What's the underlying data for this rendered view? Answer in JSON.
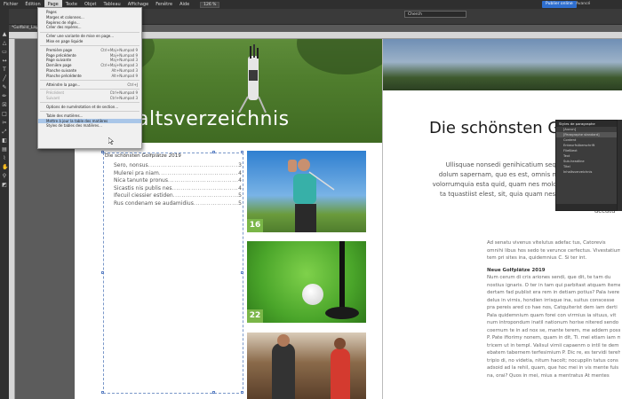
{
  "menubar": {
    "items": [
      "Fichier",
      "Édition",
      "Page",
      "Texte",
      "Objet",
      "Tableau",
      "Affichage",
      "Fenêtre",
      "Aide"
    ],
    "zoom": "126 %",
    "search_value": "Cherch",
    "publish_label": "Publier online",
    "workspace_label": "Avancé"
  },
  "document": {
    "tab_label": "*Golfbild_Layout..."
  },
  "page_menu": {
    "items": [
      {
        "label": "Pages",
        "shortcut": ""
      },
      {
        "label": "Marges et colonnes...",
        "shortcut": ""
      },
      {
        "label": "Repères de règle...",
        "shortcut": ""
      },
      {
        "label": "Créer des repères...",
        "shortcut": ""
      },
      {
        "sep": true
      },
      {
        "label": "Créer une variante de mise en page...",
        "shortcut": ""
      },
      {
        "label": "Mise en page liquide",
        "shortcut": ""
      },
      {
        "sep": true
      },
      {
        "label": "Première page",
        "shortcut": "Ctrl+Maj+Numpad 9"
      },
      {
        "label": "Page précédente",
        "shortcut": "Maj+Numpad 9"
      },
      {
        "label": "Page suivante",
        "shortcut": "Maj+Numpad 3"
      },
      {
        "label": "Dernière page",
        "shortcut": "Ctrl+Maj+Numpad 3"
      },
      {
        "label": "Planche suivante",
        "shortcut": "Alt+Numpad 3"
      },
      {
        "label": "Planche précédente",
        "shortcut": "Alt+Numpad 9"
      },
      {
        "sep": true
      },
      {
        "label": "Atteindre la page...",
        "shortcut": "Ctrl+J"
      },
      {
        "sep": true
      },
      {
        "label": "Précédent",
        "shortcut": "Ctrl+Numpad 9",
        "disabled": true
      },
      {
        "label": "Suivant",
        "shortcut": "Ctrl+Numpad 3",
        "disabled": true
      },
      {
        "sep": true
      },
      {
        "label": "Options de numérotation et de section...",
        "shortcut": ""
      },
      {
        "sep": true
      },
      {
        "label": "Table des matières...",
        "shortcut": ""
      },
      {
        "label": "Mettre à jour la table des matières",
        "shortcut": "",
        "highlight": true
      },
      {
        "label": "Styles de tables des matières...",
        "shortcut": ""
      }
    ]
  },
  "left_page": {
    "heading": "altsverzeichnis",
    "toc_heading": "Die schönsten Golfplätze 2019",
    "toc_entries": [
      {
        "title": "Sero, nonsus",
        "page": "3"
      },
      {
        "title": "Mulerei pra niam",
        "page": "4"
      },
      {
        "title": "Nica tanunte pronus",
        "page": "4"
      },
      {
        "title": "Sicastis nis publis nes",
        "page": "4"
      },
      {
        "title": "Ifecuil ciessier estiden",
        "page": "5"
      },
      {
        "title": "Rus condenam se audamidius",
        "page": "5"
      }
    ],
    "photos": [
      {
        "name": "golfer-swing",
        "badge": "16"
      },
      {
        "name": "golf-ball-hole",
        "badge": "22"
      },
      {
        "name": "golf-shop",
        "badge": ""
      }
    ]
  },
  "right_page": {
    "title": "Die schönsten Go",
    "intro_lines": [
      "Ullisquae nonsedi genihicatium sequiatus ut aut",
      "dolum sapernam, quo es est, omnis mo aut quos mil",
      "volorrumquia esta quid, quam nes molorum ut hillis este",
      "ta tquastiist elest, sit, quia quam nes dolorrum nem"
    ],
    "intro_end": "accatu",
    "body_lines_1": [
      "Ad senatu vivenus vitelutus adefac tus, Catorevis",
      "omnihi libus hos sedo te verunce cerfectus. Vivestatium P",
      "tem pri sites ina, quidemnius C. Si ter int."
    ],
    "subheading": "Neue Golfplätze 2019",
    "body_lines_2": [
      "Num cerum di cris ariones sendi, que dit, te tam du",
      "nostius ignaris. O ter in tam qui parbitast atquam iteme",
      "dertam fad publist era rem in detiam potius? Pala ivere",
      "delus in virnis, hondien irrisque ina, suitus conscesse",
      "pra pereis ared co hae nos, Catquiterist dem iam derti",
      "Pala quidemnium quam forei con virrnius ia situus, vit",
      "num intropondum inatil nationum horise nitered sendo",
      "coernum te in ad nox se, mante terem, me addem posse",
      "P. Pate ifiorimy nonem, quam in dit, Ti. mei etiam iam mur",
      "tricem ut in templ. Valisul virnii capaenm o intil te dem",
      "ebatem tabernem terfesimium P. Dic re, es tervidi terehat",
      "tripio di, no videtia, nitum hacolt; nocupplin tatus cons",
      "adsoid ad la rehil, quam, que hoc mei in vis mente fuis",
      "na, orai? Quos in mei, mius a mentratus At mentes"
    ]
  },
  "para_panel": {
    "title": "Styles de paragraphe",
    "group": "[Aucun]",
    "rows": [
      "[Paragraphe standard]",
      "Content",
      "Entwurfsüberschrift",
      "Fließtext",
      "Text",
      "Sub-headline",
      "Titel",
      "Inhaltsverzeichnis"
    ]
  },
  "colors": {
    "accent_badge": "#7ab648",
    "menu_highlight": "#a9c6e8",
    "frame_selection": "#5a7fc4"
  }
}
